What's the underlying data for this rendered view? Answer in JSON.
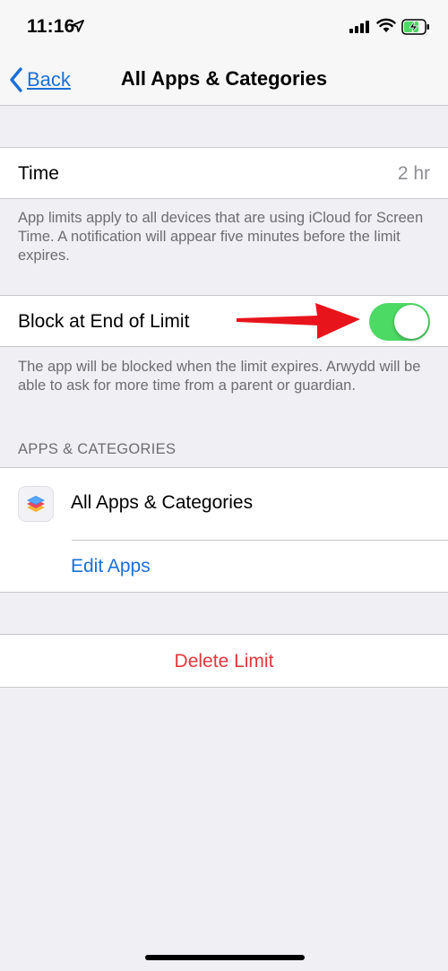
{
  "status_bar": {
    "time": "11:16",
    "icons": [
      "location-arrow-icon",
      "cellular-signal-icon",
      "wifi-icon",
      "battery-charging-icon"
    ]
  },
  "nav": {
    "back_label": "Back",
    "title": "All Apps & Categories"
  },
  "time_row": {
    "label": "Time",
    "value": "2 hr"
  },
  "time_footer": "App limits apply to all devices that are using iCloud for Screen Time. A notification will appear five minutes before the limit expires.",
  "block_row": {
    "label": "Block at End of Limit",
    "toggle_on": true
  },
  "block_footer": "The app will be blocked when the limit expires. Arwydd will be able to ask for more time from a parent or guardian.",
  "apps_section": {
    "header": "APPS & CATEGORIES",
    "item_label": "All Apps & Categories",
    "edit_label": "Edit Apps"
  },
  "delete_label": "Delete Limit",
  "colors": {
    "accent": "#1a6fd8",
    "toggle_on": "#4cd964",
    "destructive": "#e0383e",
    "annotation_arrow": "#e8141c"
  }
}
